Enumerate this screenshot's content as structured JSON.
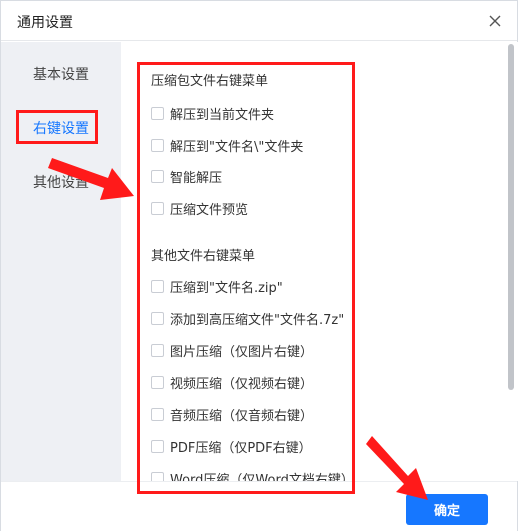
{
  "dialog": {
    "title": "通用设置",
    "close_icon": "close-icon"
  },
  "sidebar": {
    "items": [
      {
        "label": "基本设置",
        "active": false
      },
      {
        "label": "右键设置",
        "active": true
      },
      {
        "label": "其他设置",
        "active": false
      }
    ]
  },
  "sections": [
    {
      "title": "压缩包文件右键菜单",
      "options": [
        {
          "label": "解压到当前文件夹",
          "checked": false
        },
        {
          "label": "解压到\"文件名\\\"文件夹",
          "checked": false
        },
        {
          "label": "智能解压",
          "checked": false
        },
        {
          "label": "压缩文件预览",
          "checked": false
        }
      ]
    },
    {
      "title": "其他文件右键菜单",
      "options": [
        {
          "label": "压缩到\"文件名.zip\"",
          "checked": false
        },
        {
          "label": "添加到高压缩文件\"文件名.7z\"",
          "checked": false
        },
        {
          "label": "图片压缩（仅图片右键）",
          "checked": false
        },
        {
          "label": "视频压缩（仅视频右键）",
          "checked": false
        },
        {
          "label": "音频压缩（仅音频右键）",
          "checked": false
        },
        {
          "label": "PDF压缩（仅PDF右键）",
          "checked": false
        },
        {
          "label": "Word压缩（仅Word文档右键）",
          "checked": false
        }
      ]
    }
  ],
  "footer": {
    "ok_label": "确定"
  },
  "colors": {
    "accent": "#1677ff",
    "highlight": "#ff1a1a",
    "sidebar_bg": "#eef0f4"
  }
}
